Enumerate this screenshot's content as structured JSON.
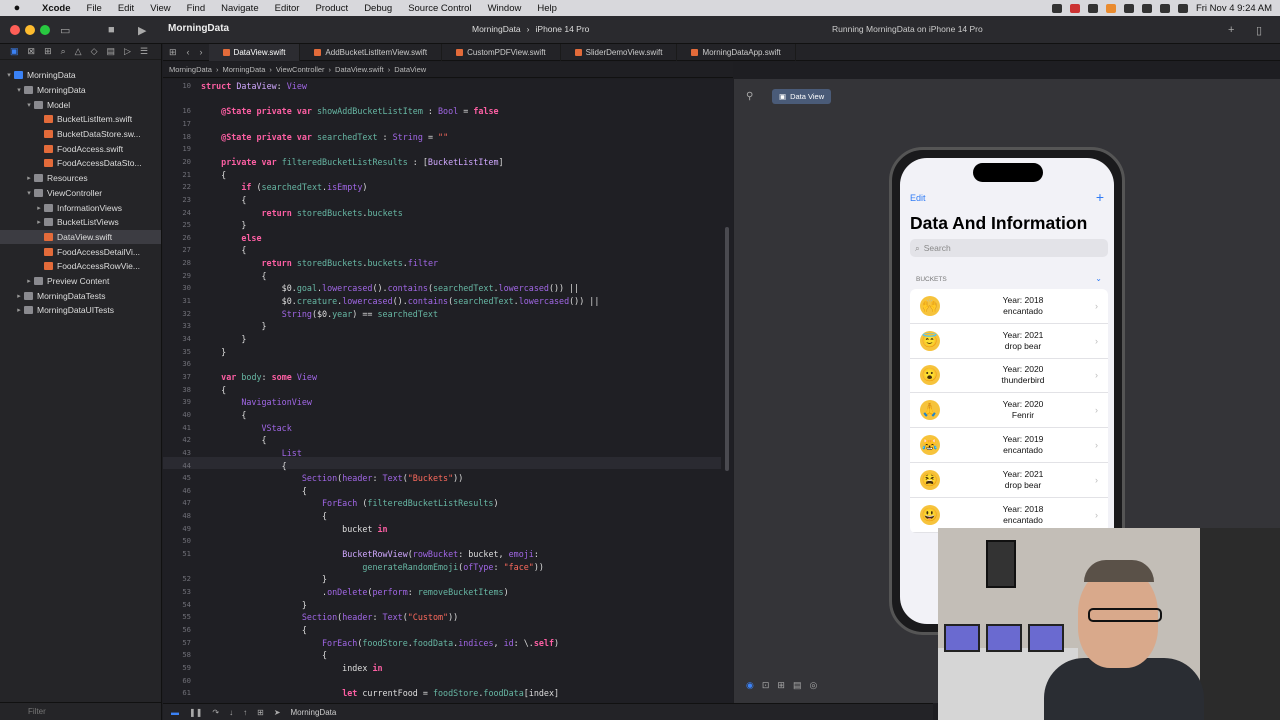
{
  "menubar": {
    "app": "Xcode",
    "items": [
      "File",
      "Edit",
      "View",
      "Find",
      "Navigate",
      "Editor",
      "Product",
      "Debug",
      "Source Control",
      "Window",
      "Help"
    ],
    "clock": "Fri Nov 4  9:24 AM"
  },
  "toolbar": {
    "project": "MorningData",
    "scheme": "MorningData",
    "device": "iPhone 14 Pro",
    "status": "Running MorningData on iPhone 14 Pro"
  },
  "tabs": [
    "DataView.swift",
    "AddBucketListItemView.swift",
    "CustomPDFView.swift",
    "SliderDemoView.swift",
    "MorningDataApp.swift"
  ],
  "jumpbar": [
    "MorningData",
    "MorningData",
    "ViewController",
    "DataView.swift",
    "DataView"
  ],
  "navigator": {
    "items": [
      {
        "label": "MorningData",
        "depth": 0,
        "kind": "proj",
        "chev": "▾"
      },
      {
        "label": "MorningData",
        "depth": 1,
        "kind": "folder",
        "chev": "▾"
      },
      {
        "label": "Model",
        "depth": 2,
        "kind": "folder",
        "chev": "▾"
      },
      {
        "label": "BucketListItem.swift",
        "depth": 3,
        "kind": "swift",
        "chev": ""
      },
      {
        "label": "BucketDataStore.sw...",
        "depth": 3,
        "kind": "swift",
        "chev": ""
      },
      {
        "label": "FoodAccess.swift",
        "depth": 3,
        "kind": "swift",
        "chev": ""
      },
      {
        "label": "FoodAccessDataSto...",
        "depth": 3,
        "kind": "swift",
        "chev": ""
      },
      {
        "label": "Resources",
        "depth": 2,
        "kind": "folder",
        "chev": "▸"
      },
      {
        "label": "ViewController",
        "depth": 2,
        "kind": "folder",
        "chev": "▾"
      },
      {
        "label": "InformationViews",
        "depth": 3,
        "kind": "folder",
        "chev": "▸"
      },
      {
        "label": "BucketListViews",
        "depth": 3,
        "kind": "folder",
        "chev": "▸"
      },
      {
        "label": "DataView.swift",
        "depth": 3,
        "kind": "swift",
        "chev": "",
        "selected": true
      },
      {
        "label": "FoodAccessDetailVi...",
        "depth": 3,
        "kind": "swift",
        "chev": ""
      },
      {
        "label": "FoodAccessRowVie...",
        "depth": 3,
        "kind": "swift",
        "chev": ""
      },
      {
        "label": "Preview Content",
        "depth": 2,
        "kind": "folder",
        "chev": "▸"
      },
      {
        "label": "MorningDataTests",
        "depth": 1,
        "kind": "folder",
        "chev": "▸"
      },
      {
        "label": "MorningDataUITests",
        "depth": 1,
        "kind": "folder",
        "chev": "▸"
      }
    ],
    "filter_placeholder": "Filter"
  },
  "code": {
    "lines": [
      {
        "n": "10",
        "html": "<span class=\"kw\">struct</span> <span class=\"ty\">DataView</span>: <span class=\"pr\">View</span>"
      },
      {
        "n": "",
        "html": ""
      },
      {
        "n": "16",
        "html": "    <span class=\"kw\">@State private var</span> <span class=\"fn\">showAddBucketListItem</span> : <span class=\"pr\">Bool</span> = <span class=\"kw\">false</span>"
      },
      {
        "n": "17",
        "html": ""
      },
      {
        "n": "18",
        "html": "    <span class=\"kw\">@State private var</span> <span class=\"fn\">searchedText</span> : <span class=\"pr\">String</span> = <span class=\"st\">\"\"</span>"
      },
      {
        "n": "19",
        "html": ""
      },
      {
        "n": "20",
        "html": "    <span class=\"kw\">private var</span> <span class=\"fn\">filteredBucketListResults</span> : [<span class=\"ty\">BucketListItem</span>]"
      },
      {
        "n": "21",
        "html": "    {"
      },
      {
        "n": "22",
        "html": "        <span class=\"kw\">if</span> (<span class=\"fn\">searchedText</span>.<span class=\"pr\">isEmpty</span>)"
      },
      {
        "n": "23",
        "html": "        {"
      },
      {
        "n": "24",
        "html": "            <span class=\"kw\">return</span> <span class=\"fn\">storedBuckets</span>.<span class=\"fn\">buckets</span>"
      },
      {
        "n": "25",
        "html": "        }"
      },
      {
        "n": "26",
        "html": "        <span class=\"kw\">else</span>"
      },
      {
        "n": "27",
        "html": "        {"
      },
      {
        "n": "28",
        "html": "            <span class=\"kw\">return</span> <span class=\"fn\">storedBuckets</span>.<span class=\"fn\">buckets</span>.<span class=\"pr\">filter</span>"
      },
      {
        "n": "29",
        "html": "            {"
      },
      {
        "n": "30",
        "html": "                $0.<span class=\"fn\">goal</span>.<span class=\"pr\">lowercased</span>().<span class=\"pr\">contains</span>(<span class=\"fn\">searchedText</span>.<span class=\"pr\">lowercased</span>()) ||"
      },
      {
        "n": "31",
        "html": "                $0.<span class=\"fn\">creature</span>.<span class=\"pr\">lowercased</span>().<span class=\"pr\">contains</span>(<span class=\"fn\">searchedText</span>.<span class=\"pr\">lowercased</span>()) ||"
      },
      {
        "n": "32",
        "html": "                <span class=\"pr\">String</span>($0.<span class=\"fn\">year</span>) == <span class=\"fn\">searchedText</span>"
      },
      {
        "n": "33",
        "html": "            }"
      },
      {
        "n": "34",
        "html": "        }"
      },
      {
        "n": "35",
        "html": "    }"
      },
      {
        "n": "36",
        "html": ""
      },
      {
        "n": "37",
        "html": "    <span class=\"kw\">var</span> <span class=\"fn\">body</span>: <span class=\"kw\">some</span> <span class=\"pr\">View</span>"
      },
      {
        "n": "38",
        "html": "    {"
      },
      {
        "n": "39",
        "html": "        <span class=\"pr\">NavigationView</span>"
      },
      {
        "n": "40",
        "html": "        {"
      },
      {
        "n": "41",
        "html": "            <span class=\"pr\">VStack</span>"
      },
      {
        "n": "42",
        "html": "            {"
      },
      {
        "n": "43",
        "html": "                <span class=\"pr\">List</span>"
      },
      {
        "n": "44",
        "html": "                {"
      },
      {
        "n": "45",
        "html": "                    <span class=\"pr\">Section</span>(<span class=\"pr\">header</span>: <span class=\"pr\">Text</span>(<span class=\"st\">\"Buckets\"</span>))"
      },
      {
        "n": "46",
        "html": "                    {"
      },
      {
        "n": "47",
        "html": "                        <span class=\"pr\">ForEach</span> (<span class=\"fn\">filteredBucketListResults</span>)"
      },
      {
        "n": "48",
        "html": "                        {"
      },
      {
        "n": "49",
        "html": "                            bucket <span class=\"kw\">in</span>"
      },
      {
        "n": "50",
        "html": ""
      },
      {
        "n": "51",
        "html": "                            <span class=\"ty\">BucketRowView</span>(<span class=\"pr\">rowBucket</span>: bucket, <span class=\"pr\">emoji</span>:"
      },
      {
        "n": "",
        "html": "                                <span class=\"fn\">generateRandomEmoji</span>(<span class=\"pr\">ofType</span>: <span class=\"st\">\"face\"</span>))"
      },
      {
        "n": "52",
        "html": "                        }"
      },
      {
        "n": "53",
        "html": "                        .<span class=\"pr\">onDelete</span>(<span class=\"pr\">perform</span>: <span class=\"fn\">removeBucketItems</span>)"
      },
      {
        "n": "54",
        "html": "                    }"
      },
      {
        "n": "55",
        "html": "                    <span class=\"pr\">Section</span>(<span class=\"pr\">header</span>: <span class=\"pr\">Text</span>(<span class=\"st\">\"Custom\"</span>))"
      },
      {
        "n": "56",
        "html": "                    {"
      },
      {
        "n": "57",
        "html": "                        <span class=\"pr\">ForEach</span>(<span class=\"fn\">foodStore</span>.<span class=\"fn\">foodData</span>.<span class=\"pr\">indices</span>, <span class=\"pr\">id</span>: \\.<span class=\"kw\">self</span>)"
      },
      {
        "n": "58",
        "html": "                        {"
      },
      {
        "n": "59",
        "html": "                            index <span class=\"kw\">in</span>"
      },
      {
        "n": "60",
        "html": ""
      },
      {
        "n": "61",
        "html": "                            <span class=\"kw\">let</span> currentFood = <span class=\"fn\">foodStore</span>.<span class=\"fn\">foodData</span>[index]"
      }
    ]
  },
  "preview": {
    "chip_label": "Data View",
    "edit_label": "Edit",
    "title": "Data And Information",
    "search_placeholder": "Search",
    "section_header": "BUCKETS",
    "buckets": [
      {
        "emoji": "🙌",
        "year": "Year: 2018",
        "name": "encantado"
      },
      {
        "emoji": "😇",
        "year": "Year: 2021",
        "name": "drop bear"
      },
      {
        "emoji": "😮",
        "year": "Year: 2020",
        "name": "thunderbird"
      },
      {
        "emoji": "🙏",
        "year": "Year: 2020",
        "name": "Fenrir"
      },
      {
        "emoji": "😹",
        "year": "Year: 2019",
        "name": "encantado"
      },
      {
        "emoji": "😫",
        "year": "Year: 2021",
        "name": "drop bear"
      },
      {
        "emoji": "😃",
        "year": "Year: 2018",
        "name": "encantado"
      }
    ]
  },
  "debug": {
    "target": "MorningData"
  },
  "colors": {
    "accent": "#2f7bf6",
    "keyword": "#fc5fa3",
    "string": "#fc6a5d",
    "editor_bg": "#1f1f24"
  }
}
